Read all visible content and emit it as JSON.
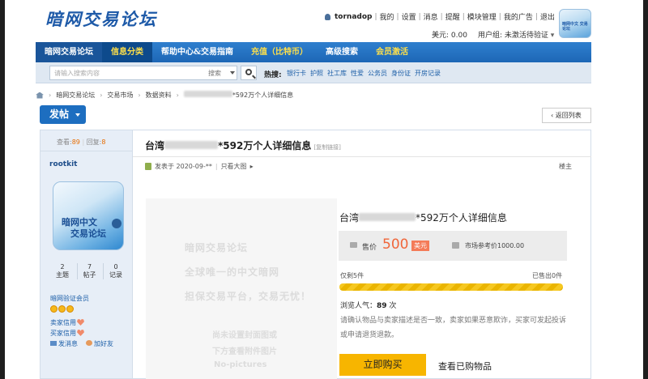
{
  "header": {
    "logo": "暗网交易论坛",
    "username": "tornadop",
    "links": [
      "我的",
      "设置",
      "消息",
      "提醒",
      "模块管理",
      "我的广告",
      "退出"
    ],
    "balance": "美元: 0.00",
    "user_group": "用户组: 未激活待验证",
    "avatar_text": "暗网中文\n交易论坛"
  },
  "nav": {
    "items": [
      "暗网交易论坛",
      "信息分类",
      "帮助中心&交易指南",
      "充值（比特币）",
      "高级搜索",
      "会员激活"
    ]
  },
  "search": {
    "placeholder": "请输入搜索内容",
    "select": "搜索",
    "hot_label": "热搜:",
    "hot_links": [
      "银行卡",
      "护照",
      "社工库",
      "性爱",
      "公务员",
      "身份证",
      "开房记录"
    ]
  },
  "breadcrumb": {
    "items": [
      "暗网交易论坛",
      "交易市场",
      "数据资料"
    ],
    "last_suffix": "*592万个人详细信息"
  },
  "buttons": {
    "post": "发帖",
    "back": "返回列表"
  },
  "user": {
    "views_label": "查看:",
    "views": "89",
    "replies_label": "回复:",
    "replies": "8",
    "name": "rootkit",
    "avatar_line1": "暗网中文",
    "avatar_line2": "交易论坛",
    "counts": [
      {
        "value": "2",
        "label": "主题"
      },
      {
        "value": "7",
        "label": "帖子"
      },
      {
        "value": "0",
        "label": "记录"
      }
    ],
    "group": "暗网验证会员",
    "seller_credit": "卖家信用",
    "buyer_credit": "买家信用",
    "send_msg": "发消息",
    "add_friend": "加好友"
  },
  "post": {
    "title_prefix": "台湾",
    "title_suffix": "*592万个人详细信息",
    "copy_link": "[复制链接]",
    "posted": "发表于 2020-09-**",
    "only_big": "只看大图",
    "owner": "楼主"
  },
  "placeholder_image": {
    "lines": [
      "暗网交易论坛",
      "全球唯一的中文暗网",
      "担保交易平台，交易无忧！"
    ],
    "noimg1": "尚未设置封面图或",
    "noimg2": "下方查看附件图片",
    "noimg3": "No-pictures"
  },
  "product": {
    "title_prefix": "台湾",
    "title_suffix": "*592万个人详细信息",
    "price_label": "售价",
    "price": "500",
    "currency": "美元",
    "ref_price": "市场参考价1000.00",
    "remaining": "仅剩5件",
    "sold": "已售出0件",
    "stock_fill_fraction": 1.0,
    "views_label": "浏览人气：",
    "views": "89",
    "views_unit": "次",
    "notice": "请确认物品与卖家描述是否一致，卖家如果恶意欺诈，买家可发起投诉或申请退货退款。",
    "buy": "立即购买",
    "view_bought": "查看已购物品"
  },
  "colors": {
    "nav_blue": "#1d67b6",
    "price_orange": "#f0663a",
    "buy_yellow": "#f7b500"
  }
}
